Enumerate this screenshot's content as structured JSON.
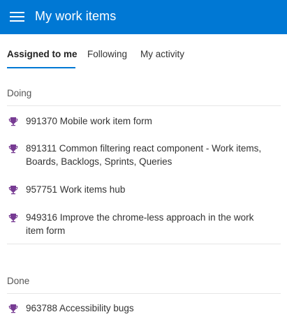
{
  "header": {
    "title": "My work items"
  },
  "tabs": [
    {
      "label": "Assigned to me"
    },
    {
      "label": "Following"
    },
    {
      "label": "My activity"
    }
  ],
  "sections": {
    "doing": {
      "label": "Doing",
      "items": [
        {
          "id": "991370",
          "text": "991370 Mobile work item form"
        },
        {
          "id": "891311",
          "text": "891311 Common filtering react component - Work items, Boards, Backlogs, Sprints, Queries"
        },
        {
          "id": "957751",
          "text": "957751 Work items hub"
        },
        {
          "id": "949316",
          "text": "949316 Improve the chrome-less approach in the work item form"
        }
      ]
    },
    "done": {
      "label": "Done",
      "items": [
        {
          "id": "963788",
          "text": "963788 Accessibility bugs"
        }
      ]
    }
  },
  "colors": {
    "accent": "#0078d4",
    "trophy": "#773b93"
  },
  "icons": {
    "menu": "hamburger-menu-icon",
    "work_item": "trophy-icon"
  }
}
